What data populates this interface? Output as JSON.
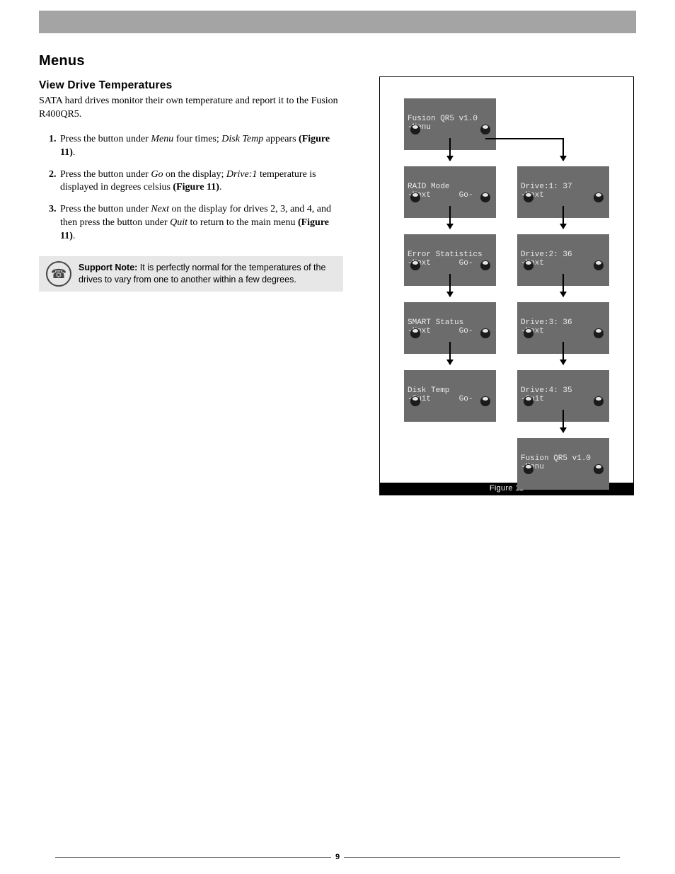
{
  "page_number": "9",
  "heading_main": "Menus",
  "heading_sub": "View Drive Temperatures",
  "intro": "SATA hard drives monitor their own temperature and report it to the Fusion R400QR5.",
  "steps": {
    "s1": {
      "pre": "Press the button under ",
      "em1": "Menu",
      "mid": " four times; ",
      "em2": "Disk Temp",
      "post": " appears ",
      "fig": "(Figure 11)",
      "tail": "."
    },
    "s2": {
      "pre": "Press the button under ",
      "em1": "Go",
      "mid": " on the display; ",
      "em2": "Drive:1",
      "post": " temperature is displayed in degrees celsius ",
      "fig": "(Figure 11)",
      "tail": "."
    },
    "s3": {
      "pre": "Press the button under ",
      "em1": "Next",
      "mid1": " on the display for drives 2, 3, and 4, and then press the button under ",
      "em2": "Quit",
      "mid2": " to return to the main menu ",
      "fig": "(Figure 11)",
      "tail": "."
    }
  },
  "note": {
    "title": "Support Note:",
    "body": " It is perfectly normal for the temperatures of the drives to vary from one to another within a few degrees."
  },
  "figure": {
    "caption": "Figure 11",
    "left": {
      "n0": {
        "l1": "Fusion QR5 v1.0",
        "l2": "-Menu"
      },
      "n1": {
        "l1": "RAID Mode",
        "l2": "-Next      Go-"
      },
      "n2": {
        "l1": "Error Statistics",
        "l2": "-Next      Go-"
      },
      "n3": {
        "l1": "SMART Status",
        "l2": "-Next      Go-"
      },
      "n4": {
        "l1": "Disk Temp",
        "l2": "-Quit      Go-"
      }
    },
    "right": {
      "n1": {
        "l1": "Drive:1: 37",
        "l2": "-Next"
      },
      "n2": {
        "l1": "Drive:2: 36",
        "l2": "-Next"
      },
      "n3": {
        "l1": "Drive:3: 36",
        "l2": "-Next"
      },
      "n4": {
        "l1": "Drive:4: 35",
        "l2": "-Quit"
      },
      "n5": {
        "l1": "Fusion QR5 v1.0",
        "l2": "-Menu"
      }
    }
  }
}
